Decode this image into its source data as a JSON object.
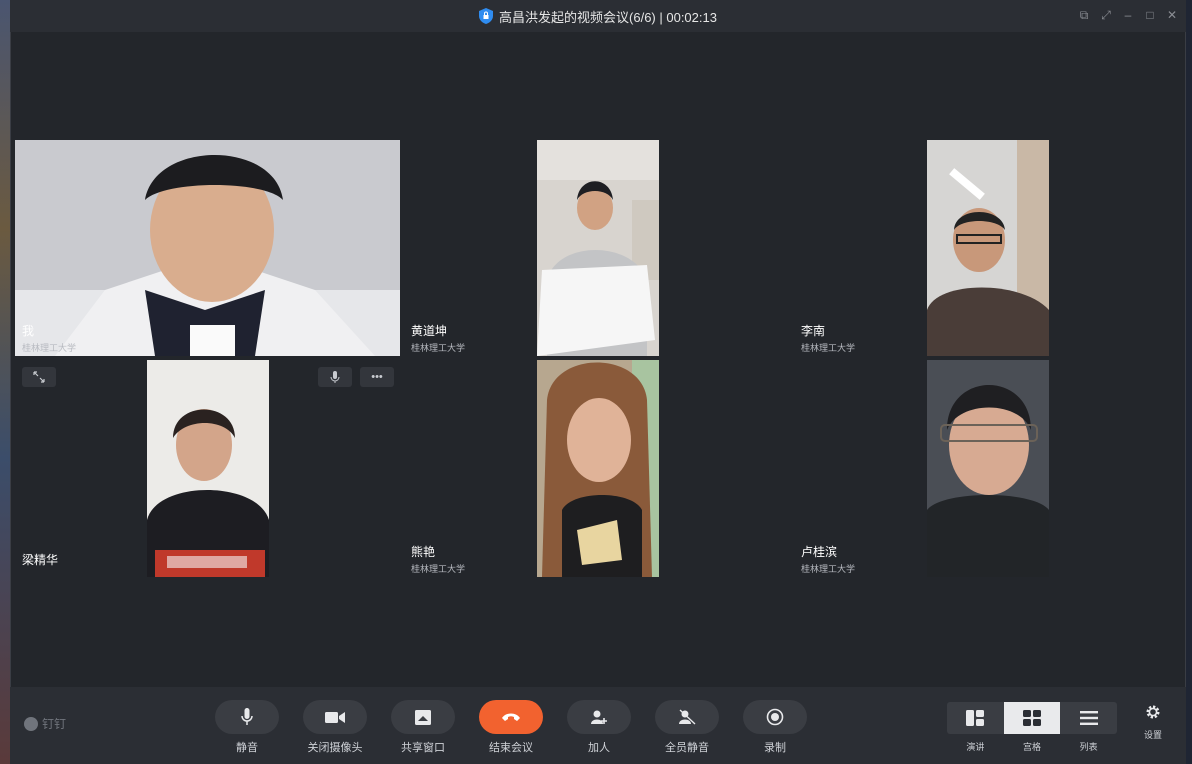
{
  "window": {
    "title": "高昌洪发起的视频会议(6/6) | 00:02:13"
  },
  "participants": [
    {
      "name": "我",
      "org": "桂林理工大学"
    },
    {
      "name": "黄道坤",
      "org": "桂林理工大学"
    },
    {
      "name": "李南",
      "org": "桂林理工大学"
    },
    {
      "name": "梁精华",
      "org": ""
    },
    {
      "name": "熊艳",
      "org": "桂林理工大学"
    },
    {
      "name": "卢桂滨",
      "org": "桂林理工大学"
    }
  ],
  "brand": {
    "label": "钉钉"
  },
  "controls": {
    "mute": "静音",
    "camera_off": "关闭摄像头",
    "share_window": "共享窗口",
    "end_meeting": "结束会议",
    "add_person": "加人",
    "mute_all": "全员静音",
    "record": "录制"
  },
  "layouts": {
    "speaker": "演讲",
    "grid": "宫格",
    "list": "列表",
    "active": "grid"
  },
  "settings": {
    "label": "设置"
  },
  "colors": {
    "accent_end": "#f2622f",
    "background": "#23262b",
    "toolbar": "#2b2e34",
    "shield_blue": "#2f8cf0"
  },
  "icons": [
    "shield-icon",
    "mic-icon",
    "camera-icon",
    "share-icon",
    "hangup-icon",
    "add-person-icon",
    "mute-all-icon",
    "record-icon",
    "speaker-layout-icon",
    "grid-layout-icon",
    "list-layout-icon",
    "gear-icon",
    "expand-icon",
    "more-icon"
  ]
}
